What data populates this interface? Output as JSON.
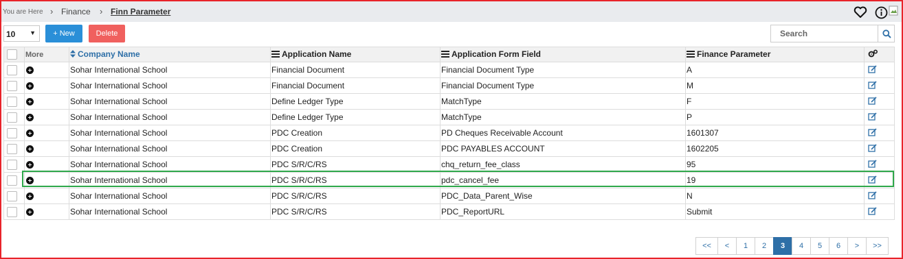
{
  "breadcrumb": {
    "prefix": "You are Here",
    "items": [
      "Finance",
      "Finn Parameter"
    ]
  },
  "toolbar": {
    "page_size": "10",
    "new_label": "+ New",
    "delete_label": "Delete",
    "search_placeholder": "Search"
  },
  "table": {
    "headers": {
      "more": "More",
      "company": "Company Name",
      "application": "Application Name",
      "form_field": "Application Form Field",
      "parameter": "Finance Parameter"
    },
    "rows": [
      {
        "company": "Sohar International School",
        "application": "Financial Document",
        "form_field": "Financial Document Type",
        "parameter": "A"
      },
      {
        "company": "Sohar International School",
        "application": "Financial Document",
        "form_field": "Financial Document Type",
        "parameter": "M"
      },
      {
        "company": "Sohar International School",
        "application": "Define Ledger Type",
        "form_field": "MatchType",
        "parameter": "F"
      },
      {
        "company": "Sohar International School",
        "application": "Define Ledger Type",
        "form_field": "MatchType",
        "parameter": "P"
      },
      {
        "company": "Sohar International School",
        "application": "PDC Creation",
        "form_field": "PD Cheques Receivable Account",
        "parameter": "1601307"
      },
      {
        "company": "Sohar International School",
        "application": "PDC Creation",
        "form_field": "PDC PAYABLES ACCOUNT",
        "parameter": "1602205"
      },
      {
        "company": "Sohar International School",
        "application": "PDC S/R/C/RS",
        "form_field": "chq_return_fee_class",
        "parameter": "95"
      },
      {
        "company": "Sohar International School",
        "application": "PDC S/R/C/RS",
        "form_field": "pdc_cancel_fee",
        "parameter": "19"
      },
      {
        "company": "Sohar International School",
        "application": "PDC S/R/C/RS",
        "form_field": "PDC_Data_Parent_Wise",
        "parameter": "N"
      },
      {
        "company": "Sohar International School",
        "application": "PDC S/R/C/RS",
        "form_field": "PDC_ReportURL",
        "parameter": "Submit"
      }
    ]
  },
  "pagination": {
    "first": "<<",
    "prev": "<",
    "pages": [
      "1",
      "2",
      "3",
      "4",
      "5",
      "6"
    ],
    "current": "3",
    "next": ">",
    "last": ">>"
  },
  "colors": {
    "accent": "#2e6fa7",
    "new_button": "#2a8fd8",
    "delete_button": "#f0605e",
    "highlight": "#2ea84a",
    "frame": "#e8232a"
  },
  "icons": {
    "favorite": "heart-icon",
    "info": "info-icon",
    "search": "search-icon",
    "settings": "gears-icon",
    "edit": "edit-icon",
    "expand": "plus-circle-icon",
    "sort": "sort-icon",
    "column_menu": "list-icon"
  }
}
